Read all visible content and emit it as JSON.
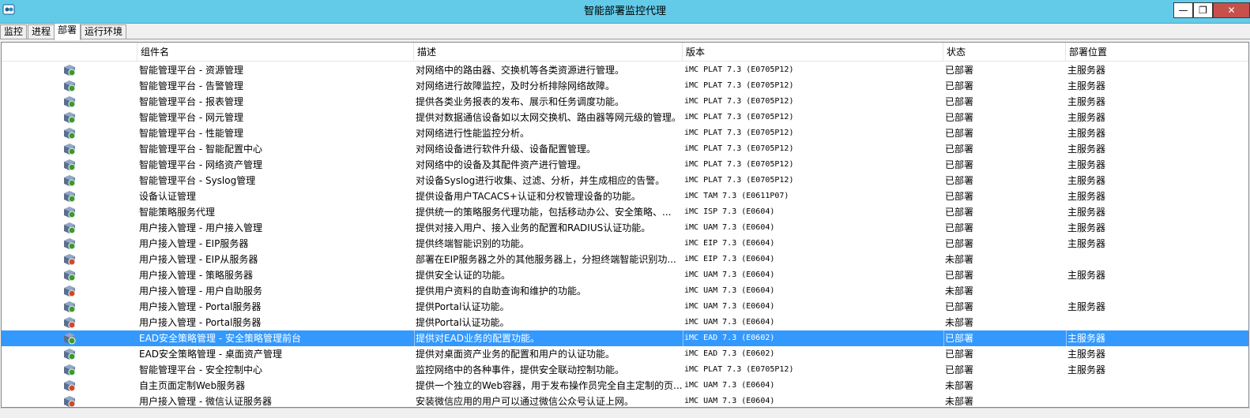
{
  "window": {
    "title": "智能部署监控代理",
    "min_glyph": "—",
    "max_glyph": "❐",
    "close_glyph": "✕"
  },
  "tabs": [
    {
      "label": "监控"
    },
    {
      "label": "进程"
    },
    {
      "label": "部署"
    },
    {
      "label": "运行环境"
    }
  ],
  "columns": {
    "name": "组件名",
    "desc": "描述",
    "version": "版本",
    "status": "状态",
    "location": "部署位置"
  },
  "colors": {
    "deployed": "#3c9a2e",
    "undeployed": "#d04a2a",
    "selection": "#3399ff",
    "titlebar": "#63cbe8"
  },
  "rows": [
    {
      "icon": "deployed-component-icon",
      "name": "智能管理平台 - 资源管理",
      "desc": "对网络中的路由器、交换机等各类资源进行管理。",
      "version": "iMC PLAT 7.3 (E0705P12)",
      "status": "已部署",
      "location": "主服务器"
    },
    {
      "icon": "deployed-component-icon",
      "name": "智能管理平台 - 告警管理",
      "desc": "对网络进行故障监控，及时分析排除网络故障。",
      "version": "iMC PLAT 7.3 (E0705P12)",
      "status": "已部署",
      "location": "主服务器"
    },
    {
      "icon": "deployed-component-icon",
      "name": "智能管理平台 - 报表管理",
      "desc": "提供各类业务报表的发布、展示和任务调度功能。",
      "version": "iMC PLAT 7.3 (E0705P12)",
      "status": "已部署",
      "location": "主服务器"
    },
    {
      "icon": "deployed-component-icon",
      "name": "智能管理平台 - 网元管理",
      "desc": "提供对数据通信设备如以太网交换机、路由器等网元级的管理。",
      "version": "iMC PLAT 7.3 (E0705P12)",
      "status": "已部署",
      "location": "主服务器"
    },
    {
      "icon": "deployed-component-icon",
      "name": "智能管理平台 - 性能管理",
      "desc": "对网络进行性能监控分析。",
      "version": "iMC PLAT 7.3 (E0705P12)",
      "status": "已部署",
      "location": "主服务器"
    },
    {
      "icon": "deployed-component-icon",
      "name": "智能管理平台 - 智能配置中心",
      "desc": "对网络设备进行软件升级、设备配置管理。",
      "version": "iMC PLAT 7.3 (E0705P12)",
      "status": "已部署",
      "location": "主服务器"
    },
    {
      "icon": "deployed-component-icon",
      "name": "智能管理平台 - 网络资产管理",
      "desc": "对网络中的设备及其配件资产进行管理。",
      "version": "iMC PLAT 7.3 (E0705P12)",
      "status": "已部署",
      "location": "主服务器"
    },
    {
      "icon": "deployed-component-icon",
      "name": "智能管理平台 - Syslog管理",
      "desc": "对设备Syslog进行收集、过滤、分析，并生成相应的告警。",
      "version": "iMC PLAT 7.3 (E0705P12)",
      "status": "已部署",
      "location": "主服务器"
    },
    {
      "icon": "deployed-component-icon",
      "name": "设备认证管理",
      "desc": "提供设备用户TACACS+认证和分权管理设备的功能。",
      "version": "iMC TAM 7.3 (E0611P07)",
      "status": "已部署",
      "location": "主服务器"
    },
    {
      "icon": "deployed-component-icon",
      "name": "智能策略服务代理",
      "desc": "提供统一的策略服务代理功能，包括移动办公、安全策略、...",
      "version": "iMC ISP 7.3 (E0604)",
      "status": "已部署",
      "location": "主服务器"
    },
    {
      "icon": "deployed-component-icon",
      "name": "用户接入管理 - 用户接入管理",
      "desc": "提供对接入用户、接入业务的配置和RADIUS认证功能。",
      "version": "iMC UAM 7.3 (E0604)",
      "status": "已部署",
      "location": "主服务器"
    },
    {
      "icon": "deployed-component-icon",
      "name": "用户接入管理 - EIP服务器",
      "desc": "提供终端智能识别的功能。",
      "version": "iMC EIP 7.3 (E0604)",
      "status": "已部署",
      "location": "主服务器"
    },
    {
      "icon": "undeployed-component-icon",
      "name": "用户接入管理 - EIP从服务器",
      "desc": "部署在EIP服务器之外的其他服务器上，分担终端智能识别功...",
      "version": "iMC EIP 7.3 (E0604)",
      "status": "未部署",
      "location": ""
    },
    {
      "icon": "deployed-component-icon",
      "name": "用户接入管理 - 策略服务器",
      "desc": "提供安全认证的功能。",
      "version": "iMC UAM 7.3 (E0604)",
      "status": "已部署",
      "location": "主服务器"
    },
    {
      "icon": "undeployed-component-icon",
      "name": "用户接入管理 - 用户自助服务",
      "desc": "提供用户资料的自助查询和维护的功能。",
      "version": "iMC UAM 7.3 (E0604)",
      "status": "未部署",
      "location": ""
    },
    {
      "icon": "deployed-component-icon",
      "name": "用户接入管理 - Portal服务器",
      "desc": "提供Portal认证功能。",
      "version": "iMC UAM 7.3 (E0604)",
      "status": "已部署",
      "location": "主服务器"
    },
    {
      "icon": "undeployed-component-icon",
      "name": "用户接入管理 - Portal服务器",
      "desc": "提供Portal认证功能。",
      "version": "iMC UAM 7.3 (E0604)",
      "status": "未部署",
      "location": ""
    },
    {
      "icon": "deployed-component-icon",
      "name": "EAD安全策略管理 - 安全策略管理前台",
      "desc": "提供对EAD业务的配置功能。",
      "version": "iMC EAD 7.3 (E0602)",
      "status": "已部署",
      "location": "主服务器",
      "selected": true
    },
    {
      "icon": "deployed-component-icon",
      "name": "EAD安全策略管理 - 桌面资产管理",
      "desc": "提供对桌面资产业务的配置和用户的认证功能。",
      "version": "iMC EAD 7.3 (E0602)",
      "status": "已部署",
      "location": "主服务器"
    },
    {
      "icon": "deployed-component-icon",
      "name": "智能管理平台 - 安全控制中心",
      "desc": "监控网络中的各种事件，提供安全联动控制功能。",
      "version": "iMC PLAT 7.3 (E0705P12)",
      "status": "已部署",
      "location": "主服务器"
    },
    {
      "icon": "undeployed-component-icon",
      "name": "自主页面定制Web服务器",
      "desc": "提供一个独立的Web容器，用于发布操作员完全自主定制的页...",
      "version": "iMC UAM 7.3 (E0604)",
      "status": "未部署",
      "location": ""
    },
    {
      "icon": "undeployed-component-icon",
      "name": "用户接入管理 - 微信认证服务器",
      "desc": "安装微信应用的用户可以通过微信公众号认证上网。",
      "version": "iMC UAM 7.3 (E0604)",
      "status": "未部署",
      "location": ""
    }
  ]
}
